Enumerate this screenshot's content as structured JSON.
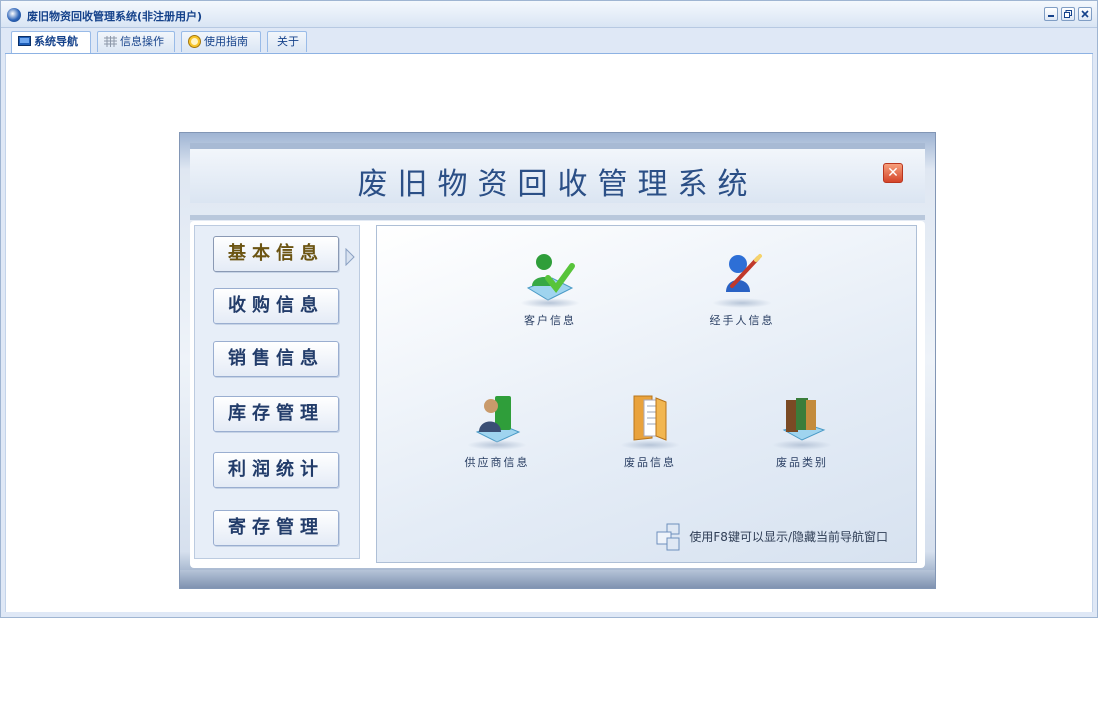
{
  "window": {
    "title": "废旧物资回收管理系统(非注册用户)"
  },
  "tabs": [
    {
      "label": "系统导航",
      "icon": "monitor-icon",
      "active": true
    },
    {
      "label": "信息操作",
      "icon": "grid-icon",
      "active": false
    },
    {
      "label": "使用指南",
      "icon": "help-icon",
      "active": false
    },
    {
      "label": "关于",
      "icon": "",
      "active": false
    }
  ],
  "nav": {
    "title": "废旧物资回收管理系统",
    "menu": [
      {
        "label": "基本信息",
        "active": true
      },
      {
        "label": "收购信息",
        "active": false
      },
      {
        "label": "销售信息",
        "active": false
      },
      {
        "label": "库存管理",
        "active": false
      },
      {
        "label": "利润统计",
        "active": false
      },
      {
        "label": "寄存管理",
        "active": false
      }
    ],
    "items": [
      {
        "label": "客户信息",
        "icon": "customer-icon"
      },
      {
        "label": "经手人信息",
        "icon": "handler-icon"
      },
      {
        "label": "供应商信息",
        "icon": "supplier-icon"
      },
      {
        "label": "废品信息",
        "icon": "folder-icon"
      },
      {
        "label": "废品类别",
        "icon": "books-icon"
      }
    ],
    "hint": "使用F8键可以显示/隐藏当前导航窗口"
  },
  "colors": {
    "accent": "#15428b",
    "title": "#2b4f86",
    "active_menu": "#6b5412"
  }
}
